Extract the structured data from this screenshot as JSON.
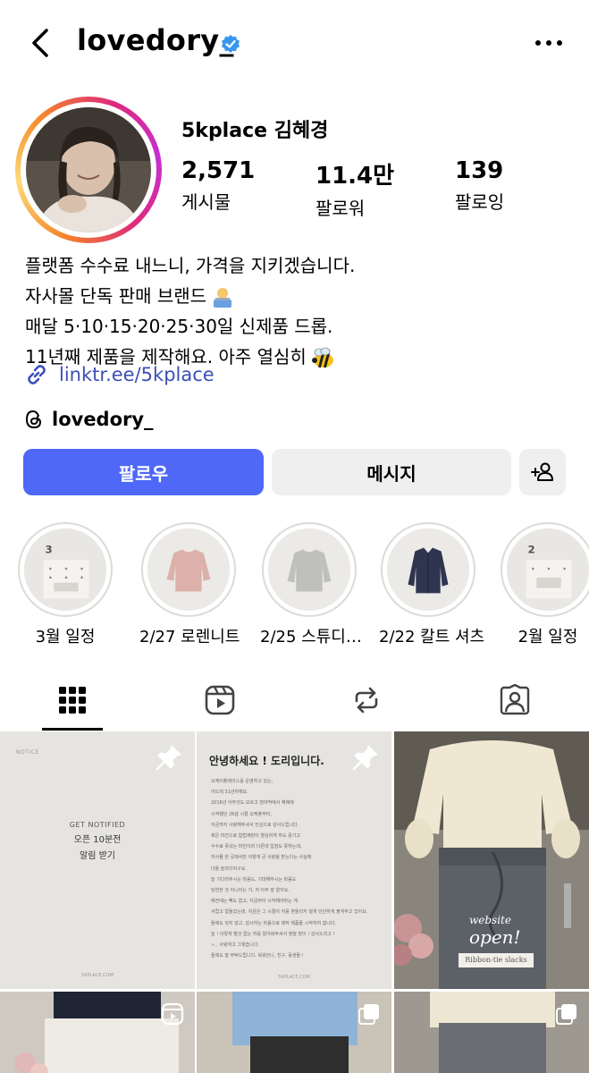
{
  "header": {
    "username": "lovedory_"
  },
  "profile": {
    "full_name": "5kplace 김혜경",
    "stats": [
      {
        "value": "2,571",
        "label": "게시물"
      },
      {
        "value": "11.4만",
        "label": "팔로워"
      },
      {
        "value": "139",
        "label": "팔로잉"
      }
    ],
    "bio": [
      "플랫폼 수수료 내느니, 가격을 지키겠습니다.",
      "자사몰 단독 판매 브랜드",
      "매달 5·10·15·20·25·30일 신제품 드롭.",
      "11년째 제품을 제작해요. 아주 열심히"
    ],
    "link": "linktr.ee/5kplace",
    "threads_handle": "lovedory_"
  },
  "actions": {
    "follow": "팔로우",
    "message": "메시지"
  },
  "highlights": [
    {
      "label": "3월 일정"
    },
    {
      "label": "2/27 로렌니트"
    },
    {
      "label": "2/25 스튜디…"
    },
    {
      "label": "2/22 칼트 셔츠"
    },
    {
      "label": "2월 일정"
    }
  ],
  "posts": {
    "post1": {
      "small_top": "NOTICE",
      "get": "GET NOTIFIED",
      "title": "오픈 10분전",
      "sub": "알림 받기",
      "footer": "5KPLACE.COM"
    },
    "post2": {
      "title": "안녕하세요 ! 도리입니다.",
      "lines": [
        "오케이플레이스를 운영하고 있는,",
        "아드레 31년차예요.",
        "2016년 아무것도 모르고 엄마딱에서 혜혜에",
        "시작했던 26살 시절 오케플부터,",
        "지금까지 사랑해주셔서 진심으로 감사드립니다.",
        "혹은 마진으로 합법제판이 열심하게 하도 뭉기고",
        "수수료 못내는 마진이라 다른데 입점도 못하는데,",
        "자사몰 한 곳에서만 이렇게 큰 사랑을 받는다는 사실에",
        "다들 놀라더라구요.",
        "늘 기다려주시는 마음도, 기대해주시는 마음도",
        "당연한 것 아니라는 거, 저 아주 잘 알아요.",
        "예전에는 빡도 없고, 지금부터 시작해야하는 게",
        "서럽고 힘들었는데, 지금은 그 시절이 저를 흔들리지 않게 단단하게 붙쳐주고 있어요.",
        "들에도 잊지 않고, 감사하는 마음으로 제작 제품들 시작하려 합니다.",
        "늘 ! 이렇게 별것 없는 저를 알아봐주셔서 정말 많이 ! 감사드리고 !",
        "ㅅ.. 사랑하고 그렇습니다.",
        "들에도 잘 부탁드립니다. 워워언니, 친구, 동생들 !"
      ],
      "footer": "5KPLACE.COM"
    },
    "post3": {
      "website": "website",
      "open": "open!",
      "tag": "Ribbon-tie slacks"
    }
  }
}
